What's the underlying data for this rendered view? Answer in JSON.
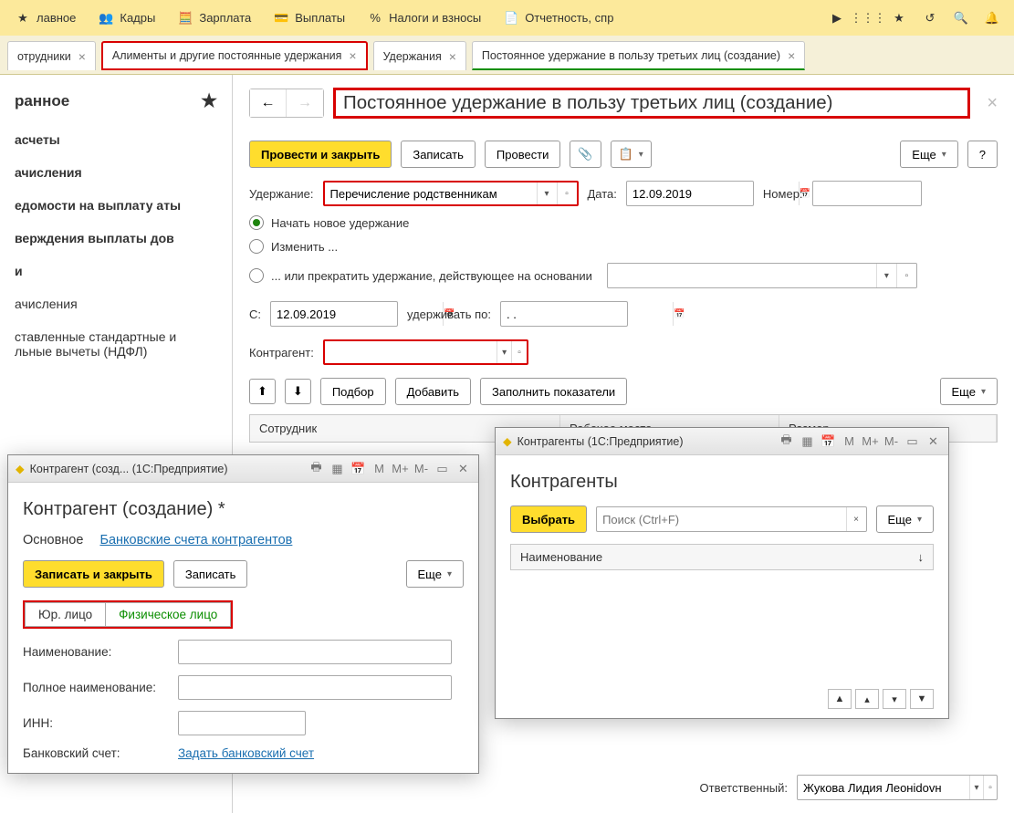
{
  "topnav": {
    "items": [
      "лавное",
      "Кадры",
      "Зарплата",
      "Выплаты",
      "Налоги и взносы",
      "Отчетность, спр"
    ]
  },
  "tabs": {
    "t0": "отрудники",
    "t1": "Алименты и другие постоянные удержания",
    "t2": "Удержания",
    "t3": "Постоянное удержание в пользу третьих лиц (создание)"
  },
  "sidebar": {
    "heading": "ранное",
    "items": [
      "асчеты",
      "ачисления",
      "едомости на выплату аты",
      "верждения выплаты дов",
      "и",
      "ачисления",
      "ставленные стандартные и льные вычеты (НДФЛ)"
    ]
  },
  "doc": {
    "title": "Постоянное удержание в пользу третьих лиц (создание)",
    "cmd": {
      "provesti_zakryt": "Провести и закрыть",
      "zapisat": "Записать",
      "provesti": "Провести",
      "esche": "Еще",
      "q": "?"
    },
    "labels": {
      "uderzhanie": "Удержание:",
      "uderzhanie_val": "Перечисление родственникам",
      "data": "Дата:",
      "data_val": "12.09.2019",
      "nomer": "Номер:",
      "nomer_val": "",
      "r1": "Начать новое удержание",
      "r2": "Изменить ...",
      "r3": "... или прекратить удержание, действующее на основании",
      "s": "С:",
      "s_val": "12.09.2019",
      "hold_to": "удерживать по:",
      "hold_to_val": ". .",
      "kontragent": "Контрагент:",
      "kontragent_val": "",
      "podbor": "Подбор",
      "dobavit": "Добавить",
      "zapolnit": "Заполнить показатели",
      "col1": "Сотрудник",
      "col2": "Рабочее место",
      "col3": "Размер",
      "resp": "Ответственный:",
      "resp_val": "Жукова Лидия Леонidovн"
    }
  },
  "dlg_create": {
    "wtitle": "Контрагент (созд...  (1С:Предприятие)",
    "h1": "Контрагент (создание) *",
    "tab_main": "Основное",
    "tab_bank": "Банковские счета контрагентов",
    "save_close": "Записать и закрыть",
    "zapisat": "Записать",
    "esche": "Еще",
    "seg_jur": "Юр. лицо",
    "seg_fiz": "Физическое лицо",
    "f_name": "Наименование:",
    "f_full": "Полное наименование:",
    "f_inn": "ИНН:",
    "f_bank": "Банковский счет:",
    "bank_link": "Задать банковский счет"
  },
  "dlg_list": {
    "wtitle": "Контрагенты (1С:Предприятие)",
    "h1": "Контрагенты",
    "select": "Выбрать",
    "search_ph": "Поиск (Ctrl+F)",
    "esche": "Еще",
    "colname": "Наименование"
  }
}
